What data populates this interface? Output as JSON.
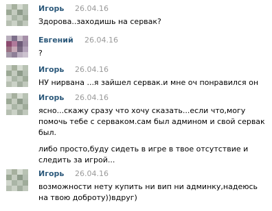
{
  "messages": [
    {
      "author": "Игорь",
      "date": "26.04.16",
      "paragraphs": [
        "Здорова..заходишь на сервак?"
      ]
    },
    {
      "author": "Евгений",
      "date": "26.04.16",
      "paragraphs": [
        "?"
      ]
    },
    {
      "author": "Игорь",
      "date": "26.04.16",
      "paragraphs": [
        "НУ нирвана ...я зайшел сервак.и мне оч понравился он"
      ]
    },
    {
      "author": "Игорь",
      "date": "26.04.16",
      "paragraphs": [
        "ясно...скажу сразу что хочу сказать...если что,могу помочь тебе с серваком.сам был админом и свой сервак был.",
        "либо просто,буду сидеть в игре в твое отсутствие и следить за игрой..."
      ]
    },
    {
      "author": "Игорь",
      "date": "26.04.16",
      "paragraphs": [
        "возможности нету купить ни вип ни админку,надеюсь на твою доброту))вдруг)"
      ]
    }
  ],
  "colors": {
    "author": "#2b587a",
    "date": "#999999",
    "text": "#000000",
    "avatar_igor": [
      "#c9d0c5",
      "#a6b09e",
      "#d5dbd1",
      "#b8c2b3",
      "#9ba895",
      "#c4cbbf",
      "#8e9b8a",
      "#b3bdb0",
      "#d0d6cc",
      "#aab5a6",
      "#bec7ba",
      "#9fab9a",
      "#b6bfb1",
      "#cbd2c7",
      "#a3ae9f",
      "#c0c8bc"
    ],
    "avatar_evgeny": [
      "#b9aebd",
      "#7d6f8a",
      "#c8bcc9",
      "#a58fa8",
      "#8c4a6f",
      "#b07a9b",
      "#6e5b78",
      "#9d8aa3",
      "#9a7184",
      "#c7a8b7",
      "#7a6a82",
      "#b3a2b9",
      "#a59aab",
      "#8f7f97",
      "#bdb1c2",
      "#ccc2cf"
    ]
  }
}
